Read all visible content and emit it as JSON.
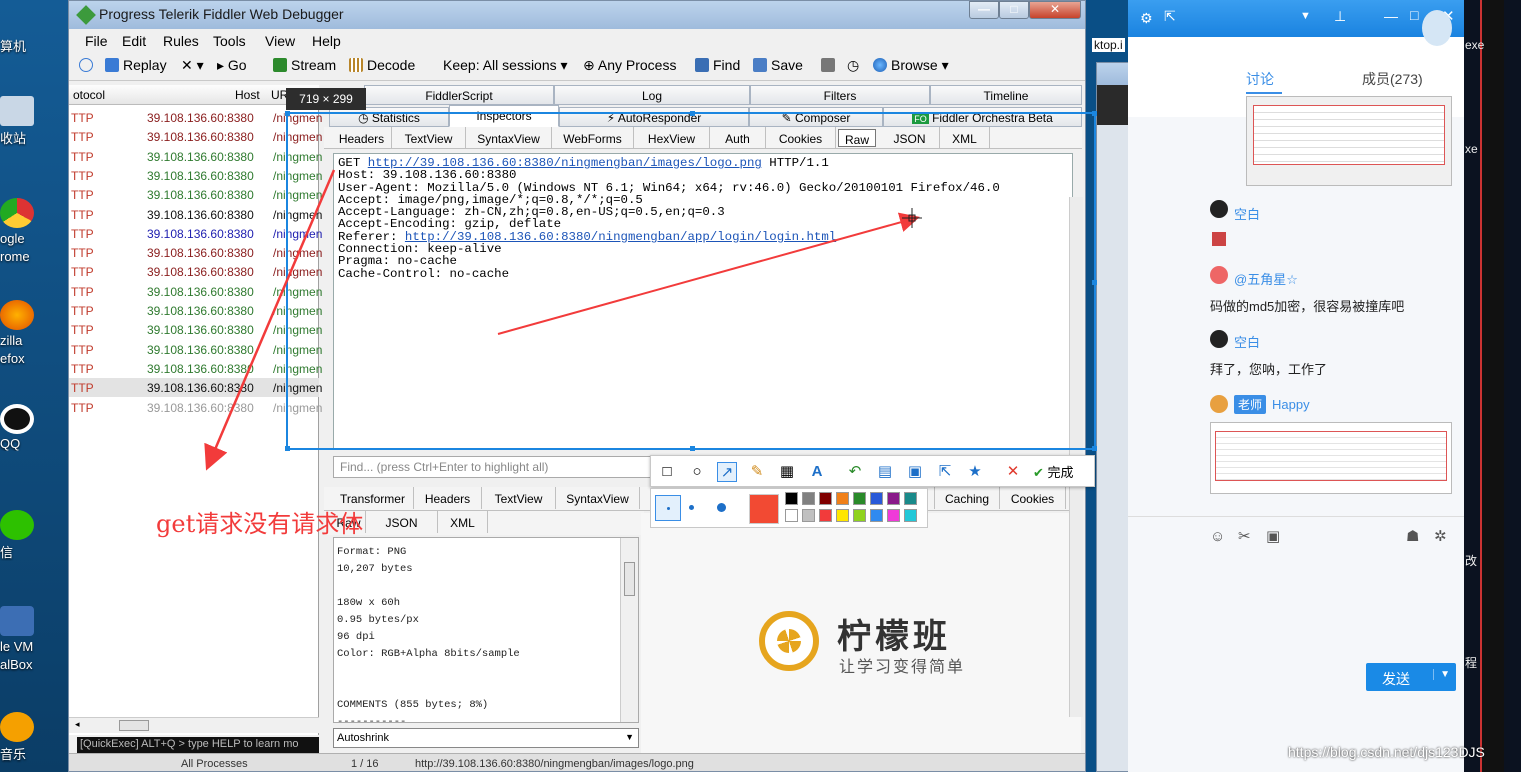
{
  "desktop": {
    "icons": [
      "算机",
      "收站",
      "ogle\nrome",
      "zilla\nefox",
      "QQ",
      "信",
      "le VM\nalBox",
      "音乐"
    ]
  },
  "fiddler": {
    "title": "Progress Telerik Fiddler Web Debugger",
    "menu": [
      "File",
      "Edit",
      "Rules",
      "Tools",
      "View",
      "Help"
    ],
    "toolbar": {
      "replay": "Replay",
      "go": "Go",
      "stream": "Stream",
      "decode": "Decode",
      "keep": "Keep: All sessions",
      "process": "Any Process",
      "find": "Find",
      "save": "Save",
      "browse": "Browse"
    },
    "session_headers": {
      "protocol": "otocol",
      "host": "Host",
      "url": "UR"
    },
    "sessions": [
      {
        "p": "TTP",
        "host": "39.108.136.60:8380",
        "url": "/ningmen",
        "color": "#8a1d1d"
      },
      {
        "p": "TTP",
        "host": "39.108.136.60:8380",
        "url": "/ningmen",
        "color": "#8a1d1d"
      },
      {
        "p": "TTP",
        "host": "39.108.136.60:8380",
        "url": "/ningmen",
        "color": "#2f7a2f"
      },
      {
        "p": "TTP",
        "host": "39.108.136.60:8380",
        "url": "/ningmen",
        "color": "#2f7a2f"
      },
      {
        "p": "TTP",
        "host": "39.108.136.60:8380",
        "url": "/ningmen",
        "color": "#2f7a2f"
      },
      {
        "p": "TTP",
        "host": "39.108.136.60:8380",
        "url": "/ningmen",
        "color": "#111111"
      },
      {
        "p": "TTP",
        "host": "39.108.136.60:8380",
        "url": "/ningmen",
        "color": "#2020b0"
      },
      {
        "p": "TTP",
        "host": "39.108.136.60:8380",
        "url": "/ningmen",
        "color": "#8a1d1d"
      },
      {
        "p": "TTP",
        "host": "39.108.136.60:8380",
        "url": "/ningmen",
        "color": "#8a1d1d"
      },
      {
        "p": "TTP",
        "host": "39.108.136.60:8380",
        "url": "/ningmen",
        "color": "#2f7a2f"
      },
      {
        "p": "TTP",
        "host": "39.108.136.60:8380",
        "url": "/ningmen",
        "color": "#2f7a2f"
      },
      {
        "p": "TTP",
        "host": "39.108.136.60:8380",
        "url": "/ningmen",
        "color": "#2f7a2f"
      },
      {
        "p": "TTP",
        "host": "39.108.136.60:8380",
        "url": "/ningmen",
        "color": "#2f7a2f"
      },
      {
        "p": "TTP",
        "host": "39.108.136.60:8380",
        "url": "/ningmen",
        "color": "#2f7a2f"
      },
      {
        "p": "TTP",
        "host": "39.108.136.60:8380",
        "url": "/ningmen",
        "color": "#111111"
      },
      {
        "p": "TTP",
        "host": "39.108.136.60:8380",
        "url": "/ningmen",
        "color": "#999999"
      }
    ],
    "quickexec": "[QuickExec] ALT+Q > type HELP to learn mo",
    "top_tabs": [
      "FiddlerScript",
      "Log",
      "Filters",
      "Timeline"
    ],
    "second_tabs": [
      "Statistics",
      "Inspectors",
      "AutoResponder",
      "Composer",
      "Fiddler Orchestra Beta"
    ],
    "request_tabs": [
      "Headers",
      "TextView",
      "SyntaxView",
      "WebForms",
      "HexView",
      "Auth",
      "Cookies",
      "Raw",
      "JSON",
      "XML"
    ],
    "request": {
      "line1_pre": "GET ",
      "line1_url": "http://39.108.136.60:8380/ningmengban/images/logo.png",
      "line1_post": " HTTP/1.1",
      "host": "Host: 39.108.136.60:8380",
      "ua": "User-Agent: Mozilla/5.0 (Windows NT 6.1; Win64; x64; rv:46.0) Gecko/20100101 Firefox/46.0",
      "accept": "Accept: image/png,image/*;q=0.8,*/*;q=0.5",
      "lang": "Accept-Language: zh-CN,zh;q=0.8,en-US;q=0.5,en;q=0.3",
      "enc": "Accept-Encoding: gzip, deflate",
      "ref_pre": "Referer: ",
      "ref_url": "http://39.108.136.60:8380/ningmengban/app/login/login.html",
      "conn": "Connection: keep-alive",
      "pragma": "Pragma: no-cache",
      "cache": "Cache-Control: no-cache"
    },
    "find_placeholder": "Find... (press Ctrl+Enter to highlight all)",
    "response_tabs1": [
      "Transformer",
      "Headers",
      "TextView",
      "SyntaxView",
      "Caching",
      "Cookies"
    ],
    "response_tabs2": [
      "Raw",
      "JSON",
      "XML"
    ],
    "response_text": "Format: PNG\n10,207 bytes\n\n180w x 60h\n0.95 bytes/px\n96 dpi\nColor: RGB+Alpha 8bits/sample\n\n\nCOMMENTS (855 bytes; 8%)\n-----------",
    "autoshrink": "Autoshrink",
    "logo_title": "柠檬班",
    "logo_sub": "让学习变得简单",
    "status": {
      "process": "All Processes",
      "count": "1 / 16",
      "url": "http://39.108.136.60:8380/ningmengban/images/logo.png"
    }
  },
  "screenshot": {
    "size": "719 × 299",
    "done": "完成",
    "annotation": "get请求没有请求体"
  },
  "chat": {
    "tab_discuss": "讨论",
    "tab_members": "成员(273)",
    "msgs": [
      {
        "name": "空白",
        "text": ""
      },
      {
        "name": "@五角星☆",
        "text": "码做的md5加密，很容易被撞库吧"
      },
      {
        "name": "空白",
        "text": "拜了，您呐，工作了"
      },
      {
        "badge": "老师",
        "name": "Happy",
        "text": ""
      }
    ],
    "send": "发送"
  },
  "side_text": {
    "a": "ktop.i",
    "b": "exe",
    "c": "xe",
    "d": "改",
    "e": "程"
  },
  "watermark": "https://blog.csdn.net/djs123DJS",
  "colors": {
    "accent": "#1b86e0",
    "annotation": "#f23b3b",
    "link": "#1d55b8"
  }
}
